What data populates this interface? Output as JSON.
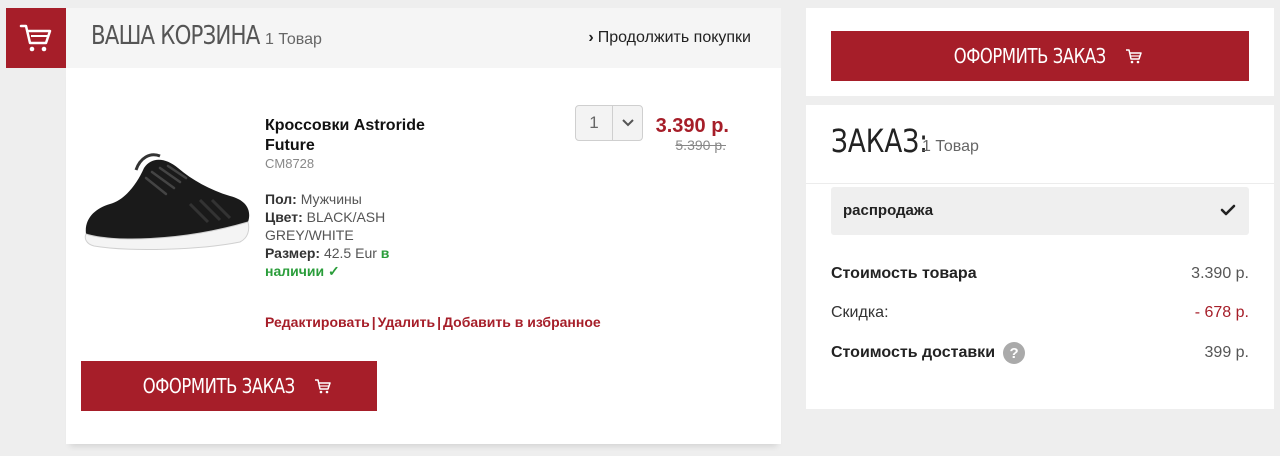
{
  "cart": {
    "title": "ВАША КОРЗИНА",
    "count": "1 Товар",
    "continue_label": "Продолжить покупки"
  },
  "item": {
    "name": "Кроссовки Astroride Future",
    "sku": "CM8728",
    "gender_label": "Пол:",
    "gender": "Мужчины",
    "color_label": "Цвет:",
    "color": "BLACK/ASH GREY/WHITE",
    "size_label": "Размер:",
    "size": "42.5 Eur",
    "stock": "в наличии ✓",
    "quantity": "1",
    "price_new": "3.390 р.",
    "price_old": "5.390 р.",
    "actions": {
      "edit": "Редактировать",
      "remove": "Удалить",
      "favorite": "Добавить в избранное"
    }
  },
  "checkout_label": "ОФОРМИТЬ ЗАКАЗ",
  "order": {
    "title": "ЗАКАЗ:",
    "count": "1 Товар",
    "promo": "распродажа",
    "subtotal_label": "Стоимость товара",
    "subtotal": "3.390 р.",
    "discount_label": "Скидка:",
    "discount": "- 678 р.",
    "delivery_label": "Стоимость доставки",
    "delivery": "399 р."
  },
  "colors": {
    "brand": "#a61e29",
    "instock": "#2a9d3a"
  },
  "icons": [
    "cart-icon",
    "chevron-right-icon",
    "chevron-down-icon",
    "check-icon",
    "help-icon",
    "shoe-image"
  ]
}
